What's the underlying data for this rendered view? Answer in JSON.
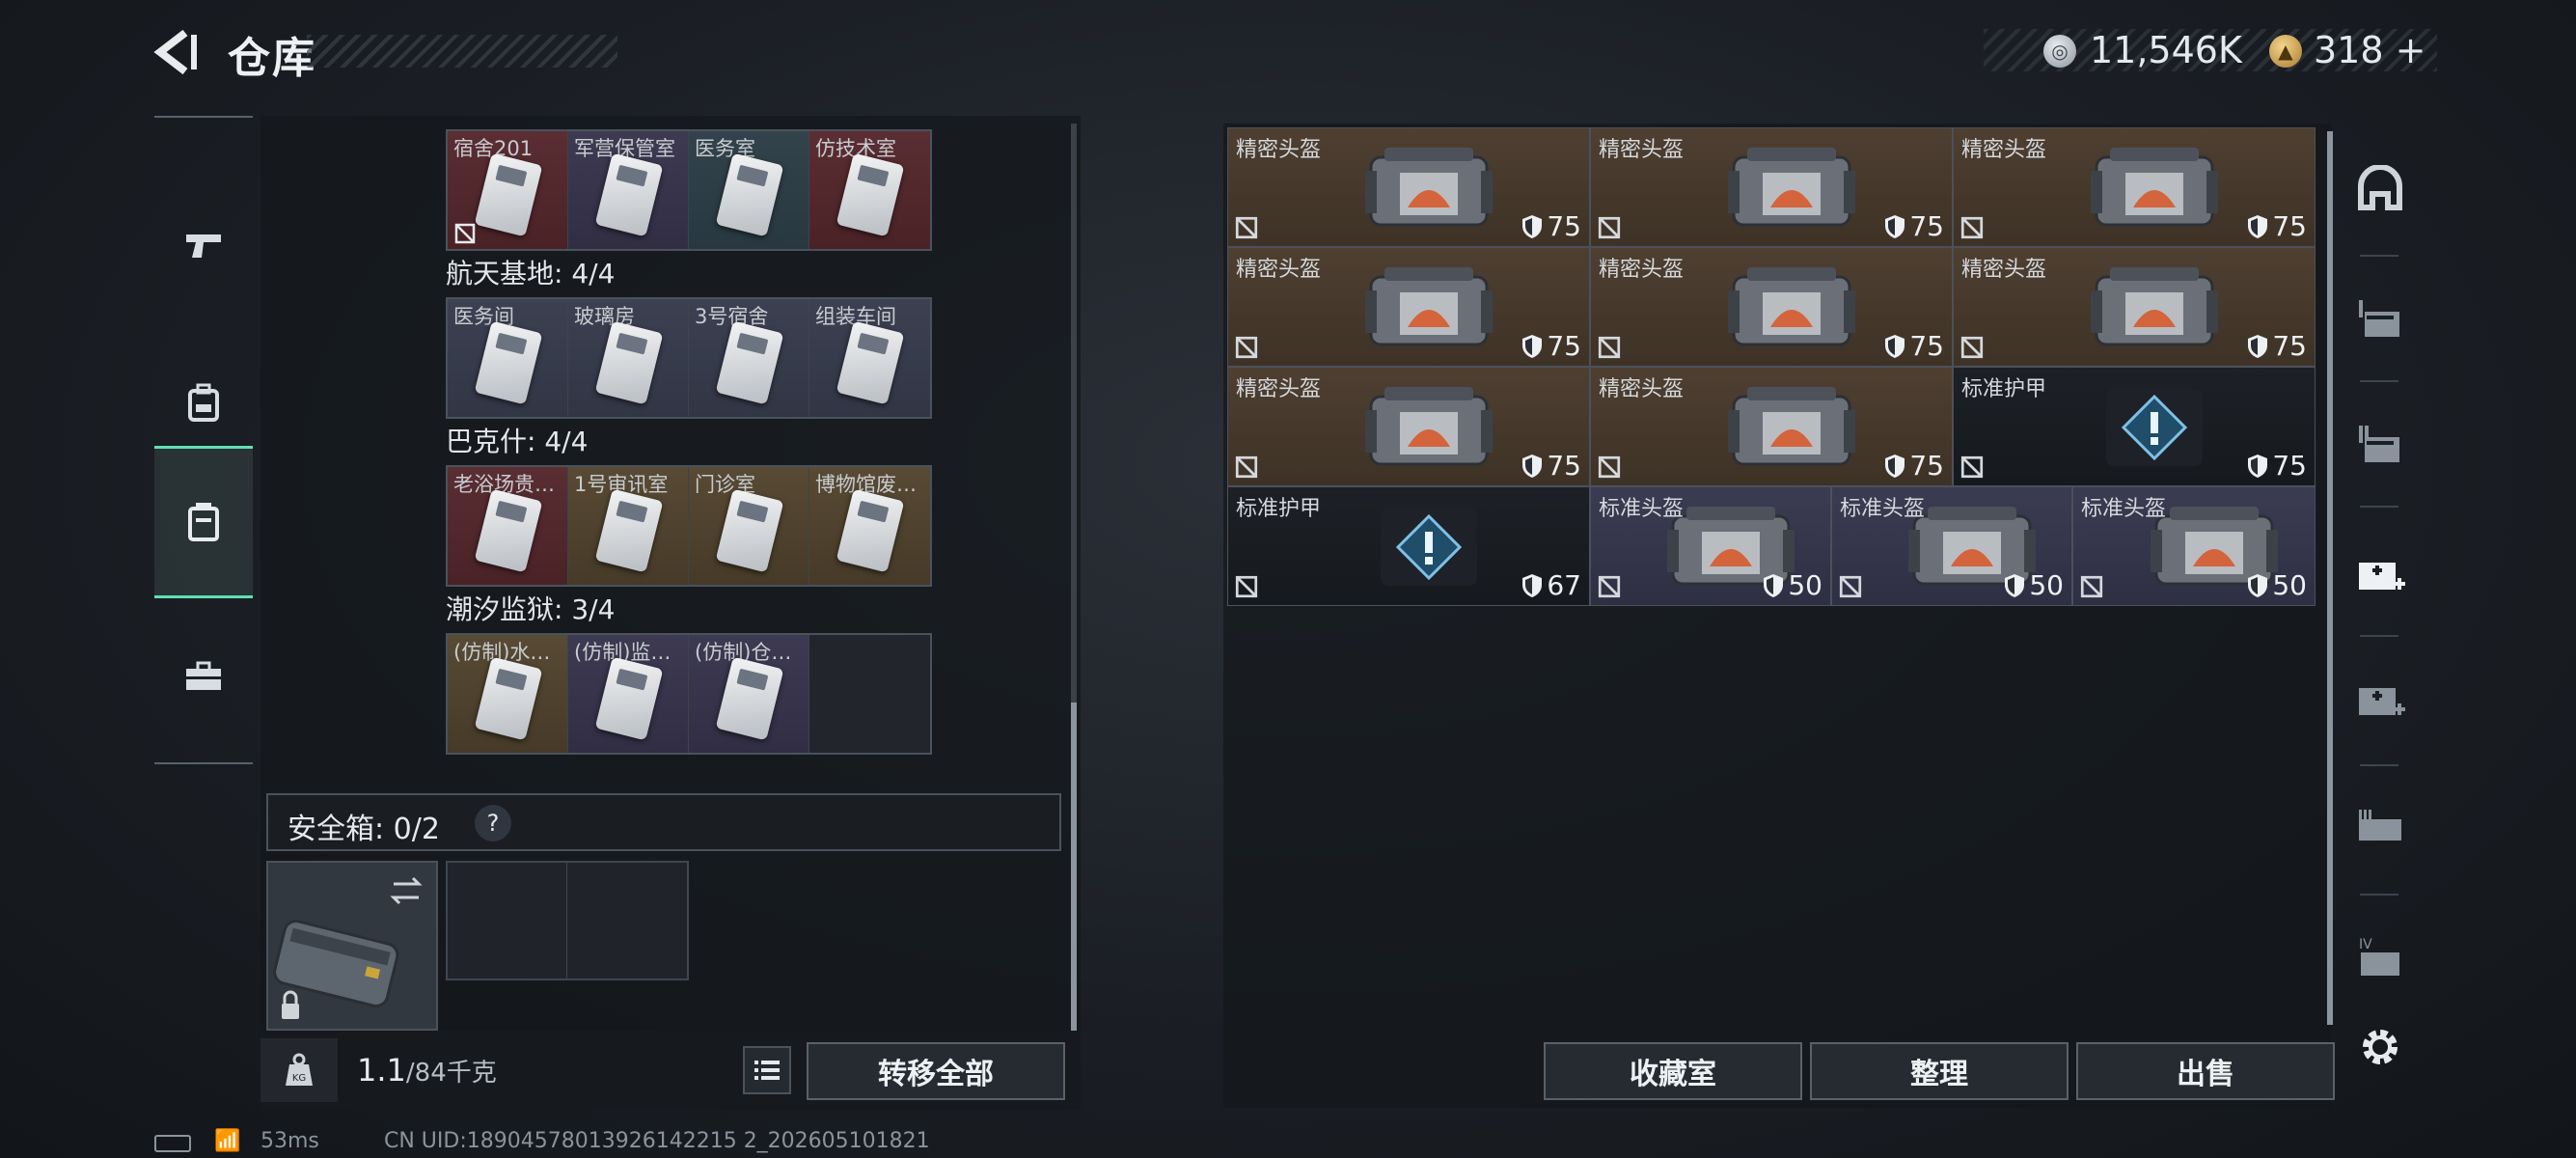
{
  "header": {
    "title": "仓库"
  },
  "currency": {
    "coins": "11,546K",
    "premium": "318",
    "premium_add": "+"
  },
  "groups": [
    {
      "label": "",
      "cells": [
        {
          "label": "宿舍201",
          "color": "red"
        },
        {
          "label": "军营保管室",
          "color": "purple"
        },
        {
          "label": "医务室",
          "color": "teal"
        },
        {
          "label": "仿技术室",
          "color": "red"
        }
      ]
    },
    {
      "label": "航天基地: 4/4",
      "cells": [
        {
          "label": "医务间",
          "color": "blue"
        },
        {
          "label": "玻璃房",
          "color": "blue"
        },
        {
          "label": "3号宿舍",
          "color": "blue"
        },
        {
          "label": "组装车间",
          "color": "blue"
        }
      ]
    },
    {
      "label": "巴克什: 4/4",
      "cells": [
        {
          "label": "老浴场贵…",
          "color": "red"
        },
        {
          "label": "1号审讯室",
          "color": "gold"
        },
        {
          "label": "门诊室",
          "color": "gold"
        },
        {
          "label": "博物馆废…",
          "color": "gold"
        }
      ]
    },
    {
      "label": "潮汐监狱: 3/4",
      "cells": [
        {
          "label": "(仿制)水…",
          "color": "gold"
        },
        {
          "label": "(仿制)监…",
          "color": "purple"
        },
        {
          "label": "(仿制)仓…",
          "color": "purple"
        },
        {
          "label": "",
          "color": "empty"
        }
      ]
    }
  ],
  "safe_box": {
    "label": "安全箱: 0/2",
    "help": "?"
  },
  "bottom_left": {
    "weight_current": "1.1",
    "weight_max": "/84千克",
    "transfer_all": "转移全部"
  },
  "items": [
    {
      "label": "精密头盔",
      "durability": "75",
      "kind": "bag",
      "bg": "brown"
    },
    {
      "label": "精密头盔",
      "durability": "75",
      "kind": "bag",
      "bg": "brown"
    },
    {
      "label": "精密头盔",
      "durability": "75",
      "kind": "bag",
      "bg": "brown"
    },
    {
      "label": "精密头盔",
      "durability": "75",
      "kind": "bag",
      "bg": "brown"
    },
    {
      "label": "精密头盔",
      "durability": "75",
      "kind": "bag",
      "bg": "brown"
    },
    {
      "label": "精密头盔",
      "durability": "75",
      "kind": "bag",
      "bg": "brown"
    },
    {
      "label": "精密头盔",
      "durability": "75",
      "kind": "bag",
      "bg": "brown"
    },
    {
      "label": "精密头盔",
      "durability": "75",
      "kind": "bag",
      "bg": "brown"
    },
    {
      "label": "标准护甲",
      "durability": "75",
      "kind": "warn",
      "bg": "dark"
    },
    {
      "label": "标准护甲",
      "durability": "67",
      "kind": "warn",
      "bg": "dark"
    },
    {
      "label": "标准头盔",
      "durability": "50",
      "kind": "bag",
      "bg": "violet"
    },
    {
      "label": "标准头盔",
      "durability": "50",
      "kind": "bag",
      "bg": "violet"
    },
    {
      "label": "标准头盔",
      "durability": "50",
      "kind": "bag",
      "bg": "violet"
    }
  ],
  "right_buttons": {
    "collection": "收藏室",
    "organize": "整理",
    "sell": "出售"
  },
  "side_icons": [
    "armor-icon",
    "storage-1-icon",
    "storage-2-icon",
    "medkit-add-icon",
    "medkit-add-2-icon",
    "weapon-case-icon",
    "ammo-case-icon",
    "settings-icon"
  ],
  "footer": {
    "ping": "53ms",
    "uid": "CN UID:18904578013926142215 2_202605101821"
  },
  "colors": {
    "accent": "#5fe0b0",
    "red_card": "#5a2e33",
    "gold_card": "#584a34",
    "brown_item": "#4e3f31",
    "violet_item": "#3b3b52"
  }
}
